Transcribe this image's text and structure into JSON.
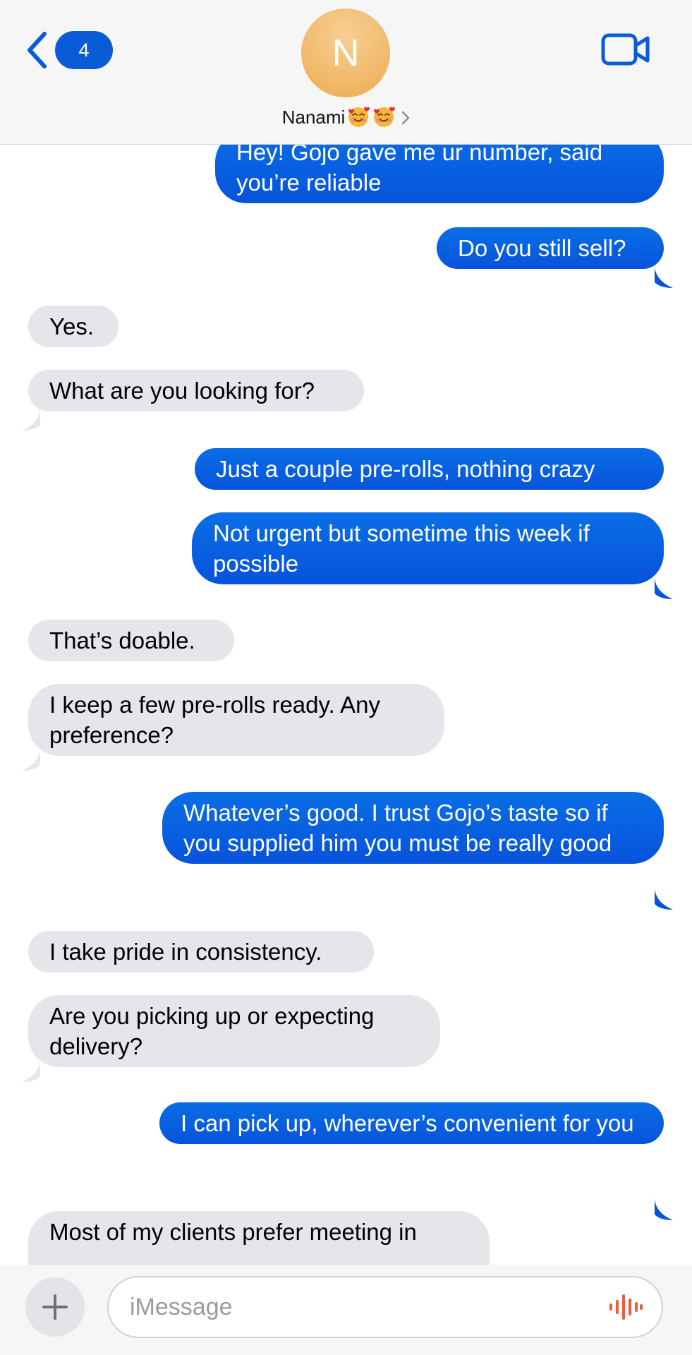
{
  "header": {
    "back_badge_count": "4",
    "avatar_initial": "N",
    "contact_name": "Nanami",
    "emoji_icons": [
      "smiling-face-with-hearts-icon",
      "smiling-face-with-hearts-icon"
    ]
  },
  "messages": [
    {
      "side": "sent",
      "text": "Hey! Gojo gave me ur number, said you’re reliable"
    },
    {
      "side": "sent",
      "text": "Do you still sell?"
    },
    {
      "side": "recv",
      "text": "Yes."
    },
    {
      "side": "recv",
      "text": "What are you looking for?"
    },
    {
      "side": "sent",
      "text": "Just a couple pre-rolls, nothing crazy"
    },
    {
      "side": "sent",
      "text": "Not urgent but sometime this week if possible"
    },
    {
      "side": "recv",
      "text": "That’s doable."
    },
    {
      "side": "recv",
      "text": "I keep a few pre-rolls ready. Any preference?"
    },
    {
      "side": "sent",
      "text": "Whatever’s good. I trust Gojo’s taste so if you supplied him you must be really good"
    },
    {
      "side": "recv",
      "text": "I take pride in consistency."
    },
    {
      "side": "recv",
      "text": "Are you picking up or expecting delivery?"
    },
    {
      "side": "sent",
      "text": "I can pick up, wherever’s convenient for you"
    },
    {
      "side": "recv",
      "text": "Most of my clients prefer meeting in"
    }
  ],
  "input": {
    "placeholder": "iMessage"
  },
  "colors": {
    "sent_bubble": "#0a6ee6",
    "recv_bubble": "#e5e5ea",
    "accent": "#0a5bd6",
    "avatar": "#f0b664",
    "voice_icon": "#ef5b3f"
  }
}
